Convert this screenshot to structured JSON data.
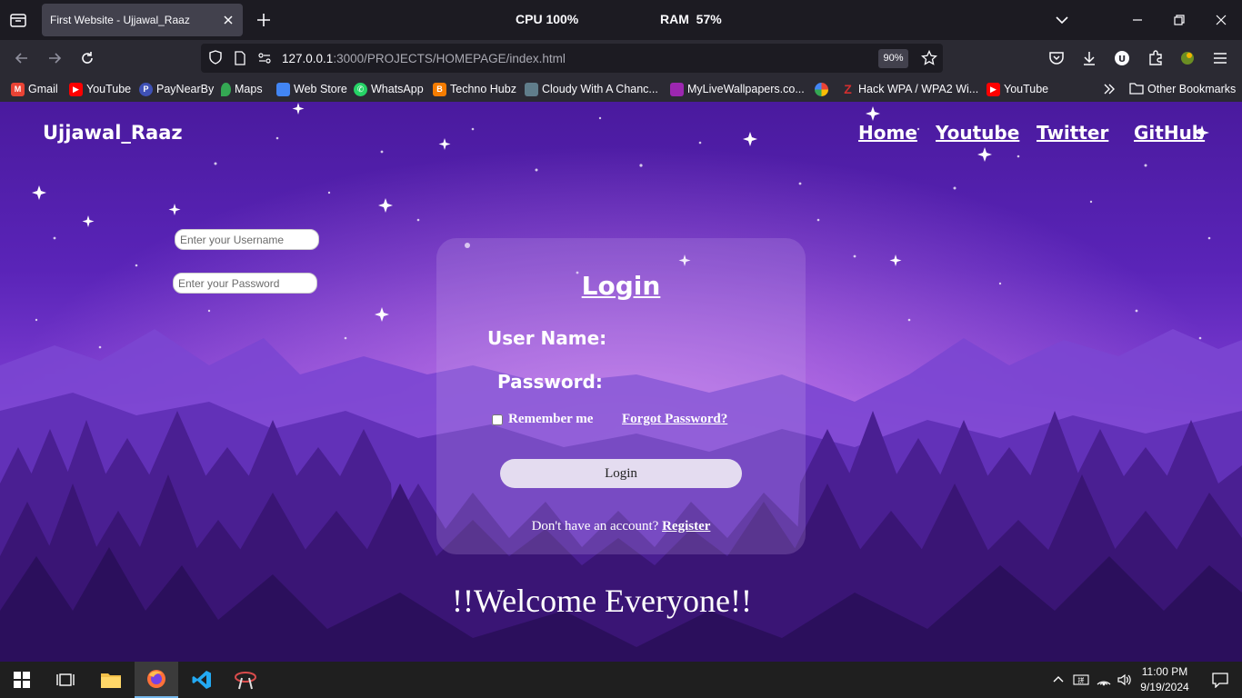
{
  "browser": {
    "tab_title": "First Website - Ujjawal_Raaz",
    "cpu": "CPU 100%",
    "ram": "RAM  57%",
    "url_host": "127.0.0.1",
    "url_path": ":3000/PROJECTS/HOMEPAGE/index.html",
    "zoom": "90%"
  },
  "bookmarks": [
    {
      "label": "Gmail",
      "icon": "gmail-icon",
      "color": "#ea4335"
    },
    {
      "label": "YouTube",
      "icon": "youtube-icon",
      "color": "#ff0000"
    },
    {
      "label": "PayNearBy",
      "icon": "paynearby-icon",
      "color": "#3f51b5"
    },
    {
      "label": "Maps",
      "icon": "maps-icon",
      "color": "#34a853"
    },
    {
      "label": "Web Store",
      "icon": "webstore-icon",
      "color": "#4285f4"
    },
    {
      "label": "WhatsApp",
      "icon": "whatsapp-icon",
      "color": "#25d366"
    },
    {
      "label": "Techno Hubz",
      "icon": "blogger-icon",
      "color": "#f57c00"
    },
    {
      "label": "Cloudy With A Chanc...",
      "icon": "cloudy-icon",
      "color": "#607d8b"
    },
    {
      "label": "MyLiveWallpapers.co...",
      "icon": "wallpaper-icon",
      "color": "#9c27b0"
    },
    {
      "label": "",
      "icon": "pinwheel-icon",
      "color": "#fbbc05"
    },
    {
      "label": "Hack WPA / WPA2 Wi...",
      "icon": "z-icon",
      "color": "#d32f2f"
    },
    {
      "label": "YouTube",
      "icon": "youtube-icon",
      "color": "#ff0000"
    }
  ],
  "other_bookmarks": "Other Bookmarks",
  "page": {
    "site_name": "Ujjawal_Raaz",
    "nav": [
      "Home",
      "Youtube",
      "Twitter",
      "GitHub"
    ],
    "login_title": "Login",
    "username_label": "User Name:",
    "username_placeholder": "Enter your Username",
    "password_label": "Password:",
    "password_placeholder": "Enter your Password",
    "remember": "Remember me",
    "forgot": "Forgot Password?",
    "login_button": "Login",
    "no_account": "Don't have an account? ",
    "register": "Register",
    "welcome": "!!Welcome Everyone!!"
  },
  "taskbar": {
    "time": "11:00 PM",
    "date": "9/19/2024"
  }
}
